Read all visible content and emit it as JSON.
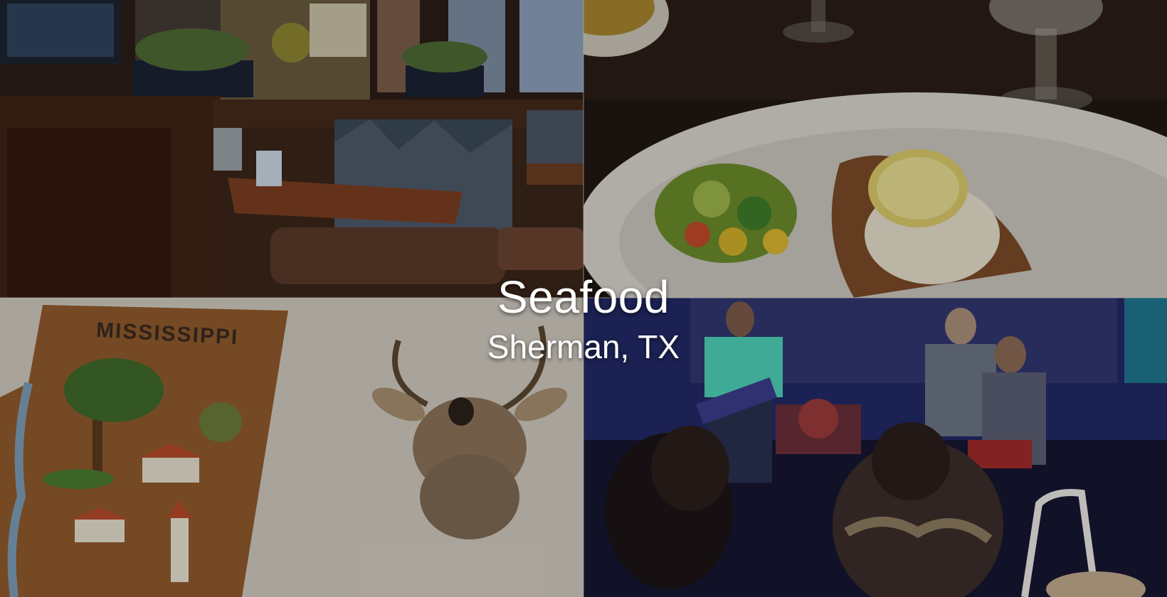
{
  "hero": {
    "title": "Seafood",
    "subtitle": "Sherman, TX"
  },
  "tiles": [
    {
      "name": "restaurant-booth-photo"
    },
    {
      "name": "seafood-plate-photo"
    },
    {
      "name": "mississippi-wall-map-and-deer-mount-photo",
      "sign_text": "MISSISSIPPI"
    },
    {
      "name": "live-band-photo"
    }
  ],
  "colors": {
    "overlay": "#000000",
    "caption": "#ffffff",
    "wood": "#4a2a1a",
    "plate": "#e9e6df",
    "wall": "#d6d0c5",
    "stage_blue": "#2b3a8f"
  }
}
